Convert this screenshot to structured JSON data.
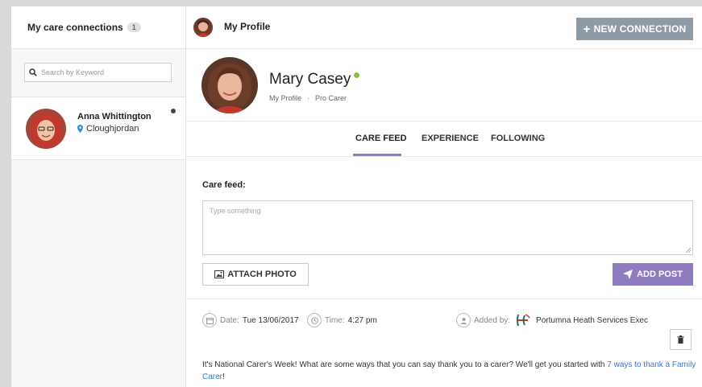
{
  "sidebar": {
    "title": "My care connections",
    "count": "1",
    "search_placeholder": "Search by Keyword",
    "contacts": [
      {
        "name": "Anna Whittington",
        "location": "Cloughjordan"
      }
    ]
  },
  "header": {
    "profile_label": "My Profile",
    "new_connection_label": "NEW CONNECTION"
  },
  "profile": {
    "name": "Mary Casey",
    "breadcrumb": [
      "My Profile",
      "·",
      "Pro Carer"
    ]
  },
  "tabs": [
    {
      "label": "CARE FEED",
      "active": true
    },
    {
      "label": "EXPERIENCE",
      "active": false
    },
    {
      "label": "FOLLOWING",
      "active": false
    }
  ],
  "care_feed": {
    "label": "Care feed:",
    "placeholder": "Type something",
    "attach_label": "ATTACH PHOTO",
    "add_post_label": "ADD POST"
  },
  "post": {
    "date_label": "Date:",
    "date": "Tue 13/06/2017",
    "time_label": "Time:",
    "time": "4:27 pm",
    "added_by_label": "Added by:",
    "added_by": "Portumna Heath Services Exec",
    "text": "It's National Carer's Week! What are some ways that you can say thank you to a carer? We'll get you started with ",
    "link_text": "7 ways to thank a Family Carer",
    "text_end": "!"
  },
  "colors": {
    "accent": "#8f7cc0",
    "new_connection_bg": "#8e9aa6",
    "online": "#7cc43b",
    "link": "#3a77c2"
  }
}
